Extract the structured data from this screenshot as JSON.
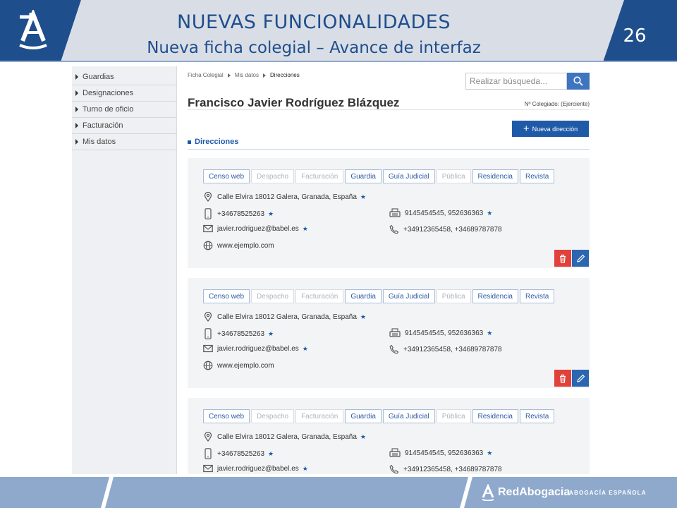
{
  "slide": {
    "title": "NUEVAS FUNCIONALIDADES",
    "subtitle": "Nueva ficha colegial – Avance de interfaz",
    "page_number": "26",
    "colors": {
      "dark_blue": "#1f4e8c",
      "light_blue": "#8ea9cc",
      "slab": "#d9dee6"
    }
  },
  "footer": {
    "brand": "RedAbogacia",
    "tagline": "ABOGACÍA ESPAÑOLA"
  },
  "sidebar": {
    "items": [
      {
        "label": "Guardias"
      },
      {
        "label": "Designaciones"
      },
      {
        "label": "Turno de oficio"
      },
      {
        "label": "Facturación"
      },
      {
        "label": "Mis datos"
      }
    ]
  },
  "breadcrumb": [
    "Ficha Colegial",
    "Mis datos",
    "Direcciones"
  ],
  "search": {
    "placeholder": "Realizar búsqueda..."
  },
  "profile": {
    "name": "Francisco Javier Rodríguez Blázquez",
    "colegiado": "Nº Colegiado: (Ejerciente)"
  },
  "actions": {
    "new_address": "Nueva dirección"
  },
  "section": {
    "title": "Direcciones"
  },
  "addresses": [
    {
      "tags": [
        {
          "label": "Censo web",
          "active": true
        },
        {
          "label": "Despacho",
          "active": false
        },
        {
          "label": "Facturación",
          "active": false
        },
        {
          "label": "Guardia",
          "active": true
        },
        {
          "label": "Guía Judicial",
          "active": true
        },
        {
          "label": "Pública",
          "active": false
        },
        {
          "label": "Residencia",
          "active": true
        },
        {
          "label": "Revista",
          "active": true
        }
      ],
      "address": "Calle Elvira 18012 Galera, Granada, España",
      "mobile": "+34678525263",
      "fax": "9145454545, 952636363",
      "email": "javier.rodriguez@babel.es",
      "phone": "+34912365458, +34689787878",
      "web": "www.ejemplo.com"
    },
    {
      "tags": [
        {
          "label": "Censo web",
          "active": true
        },
        {
          "label": "Despacho",
          "active": false
        },
        {
          "label": "Facturación",
          "active": false
        },
        {
          "label": "Guardia",
          "active": true
        },
        {
          "label": "Guía Judicial",
          "active": true
        },
        {
          "label": "Pública",
          "active": false
        },
        {
          "label": "Residencia",
          "active": true
        },
        {
          "label": "Revista",
          "active": true
        }
      ],
      "address": "Calle Elvira 18012 Galera, Granada, España",
      "mobile": "+34678525263",
      "fax": "9145454545, 952636363",
      "email": "javier.rodriguez@babel.es",
      "phone": "+34912365458, +34689787878",
      "web": "www.ejemplo.com"
    },
    {
      "tags": [
        {
          "label": "Censo web",
          "active": true
        },
        {
          "label": "Despacho",
          "active": false
        },
        {
          "label": "Facturación",
          "active": false
        },
        {
          "label": "Guardia",
          "active": true
        },
        {
          "label": "Guía Judicial",
          "active": true
        },
        {
          "label": "Pública",
          "active": false
        },
        {
          "label": "Residencia",
          "active": true
        },
        {
          "label": "Revista",
          "active": true
        }
      ],
      "address": "Calle Elvira 18012 Galera, Granada, España",
      "mobile": "+34678525263",
      "fax": "9145454545, 952636363",
      "email": "javier.rodriguez@babel.es",
      "phone": "+34912365458, +34689787878"
    }
  ]
}
